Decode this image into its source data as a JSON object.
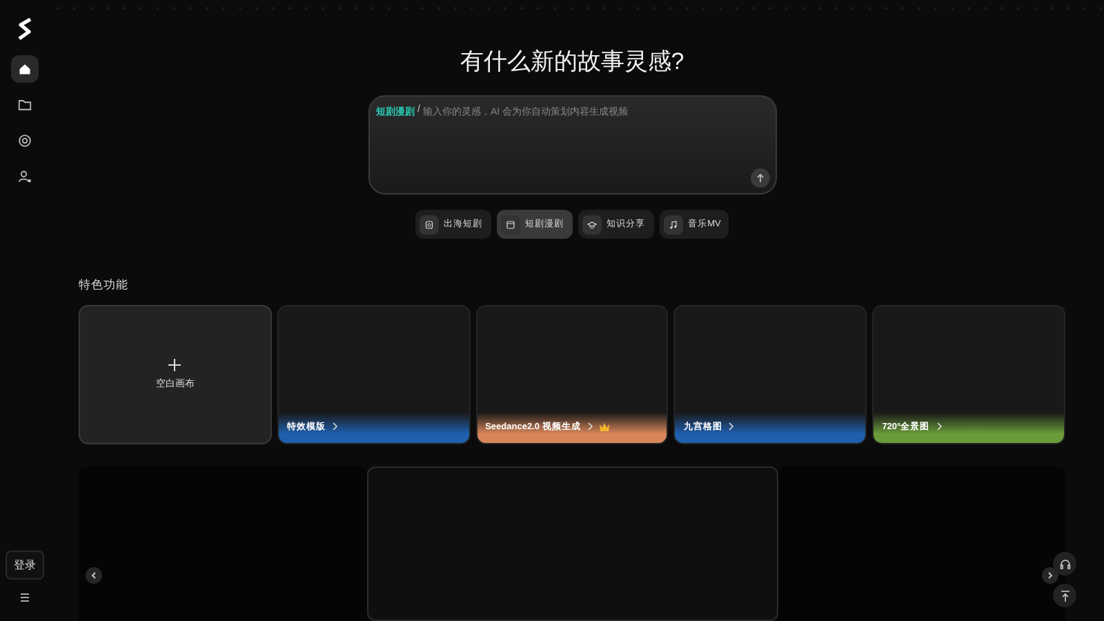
{
  "sidebar": {
    "items": [
      {
        "kind": "home",
        "selected": true
      },
      {
        "kind": "folder",
        "selected": false
      },
      {
        "kind": "badge",
        "selected": false
      },
      {
        "kind": "user",
        "selected": false
      }
    ],
    "login": "登录"
  },
  "heading": "有什么新的故事灵感?",
  "prompt": {
    "tag": "短剧漫剧",
    "separator": "/",
    "placeholder": "输入你的灵感，AI 会为你自动策划内容生成视频"
  },
  "modes": [
    {
      "label": "出海短剧",
      "kind": "globe",
      "selected": false
    },
    {
      "label": "短剧漫剧",
      "kind": "film",
      "selected": true
    },
    {
      "label": "知识分享",
      "kind": "cap",
      "selected": false
    },
    {
      "label": "音乐MV",
      "kind": "music",
      "selected": false
    }
  ],
  "features": {
    "title": "特色功能",
    "cards": [
      {
        "label": "空白画布",
        "kind": "blank"
      },
      {
        "label": "特效模版",
        "kind": "template",
        "color": "#1f5fae",
        "crown": false
      },
      {
        "label": "Seedance2.0 视频生成",
        "kind": "template",
        "color": "#d9875a",
        "crown": true
      },
      {
        "label": "九宫格图",
        "kind": "template",
        "color": "#1f5fae",
        "crown": false
      },
      {
        "label": "720°全景图",
        "kind": "template",
        "color": "#6a9c3a",
        "crown": false
      }
    ]
  }
}
